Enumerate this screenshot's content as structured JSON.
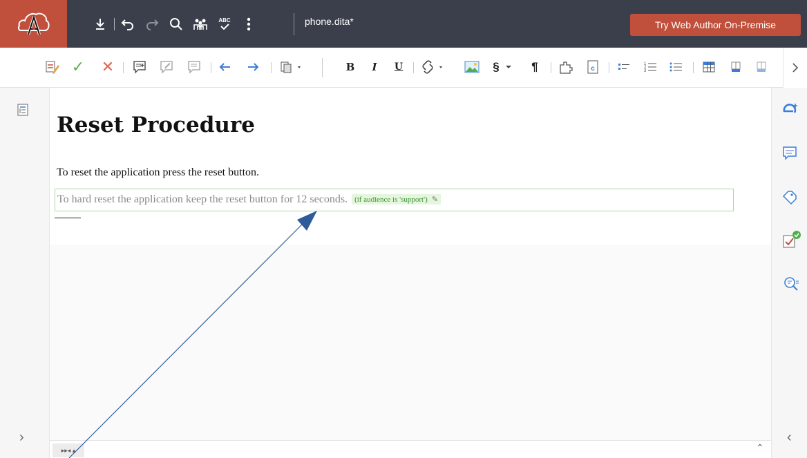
{
  "app": {
    "filename": "phone.dita*",
    "cta_label": "Try Web Author On-Premise"
  },
  "colors": {
    "topbar_bg": "#3a3f4b",
    "brand": "#c0503b",
    "condition_bg": "#e4f6dc",
    "condition_text": "#3f8f3a",
    "arrow": "#2f5b9a"
  },
  "top_toolbar": {
    "icons": [
      "download-icon",
      "undo-icon",
      "redo-icon",
      "search-icon",
      "users-icon",
      "spellcheck-icon",
      "more-vertical-icon"
    ],
    "spellcheck_text": "ABC"
  },
  "format_toolbar": {
    "bold_label": "B",
    "italic_label": "I",
    "underline_label": "U",
    "section_label": "§",
    "paragraph_label": "¶"
  },
  "document": {
    "title": "Reset Procedure",
    "paragraph1": "To reset the application press the reset button.",
    "paragraph2": "To hard reset the application keep the reset button for 12 seconds.",
    "condition_label": "(if audience is 'support')"
  },
  "left_panel": {
    "expand_label": "›"
  },
  "right_panel": {
    "collapse_label": "‹",
    "icons": [
      "elements-icon",
      "comments-icon",
      "attributes-icon",
      "validation-icon",
      "find-icon"
    ]
  },
  "statusbar": {
    "tag_label": "▸▸◂ ▴",
    "expand_label": "⌃"
  }
}
